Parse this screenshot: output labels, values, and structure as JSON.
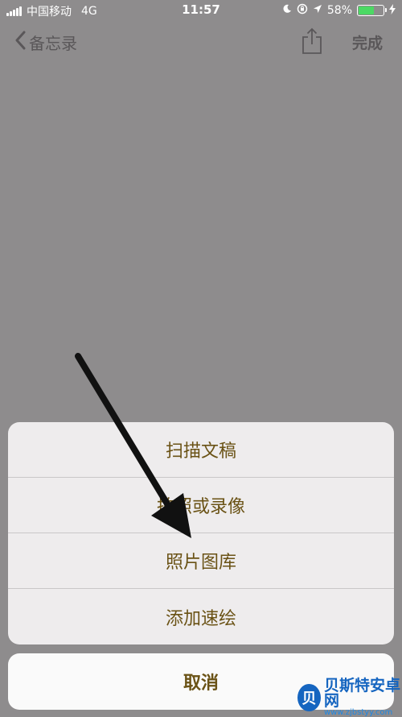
{
  "status_bar": {
    "carrier": "中国移动",
    "network": "4G",
    "time": "11:57",
    "battery_percent": "58%",
    "battery_level": 0.58,
    "icons": [
      "signal-icon",
      "moon-icon",
      "orientation-lock-icon",
      "location-icon",
      "battery-icon",
      "charging-icon"
    ]
  },
  "nav": {
    "back_label": "备忘录",
    "done_label": "完成"
  },
  "action_sheet": {
    "items": [
      "扫描文稿",
      "拍照或录像",
      "照片图库",
      "添加速绘"
    ],
    "cancel_label": "取消"
  },
  "watermark": {
    "logo_char": "贝",
    "name": "贝斯特安卓网",
    "url": "www.zjbstyy.com"
  },
  "colors": {
    "background": "#8e8c8d",
    "action_text": "#6a5215",
    "battery_fill": "#4cd964",
    "watermark_blue": "#1565c0"
  }
}
